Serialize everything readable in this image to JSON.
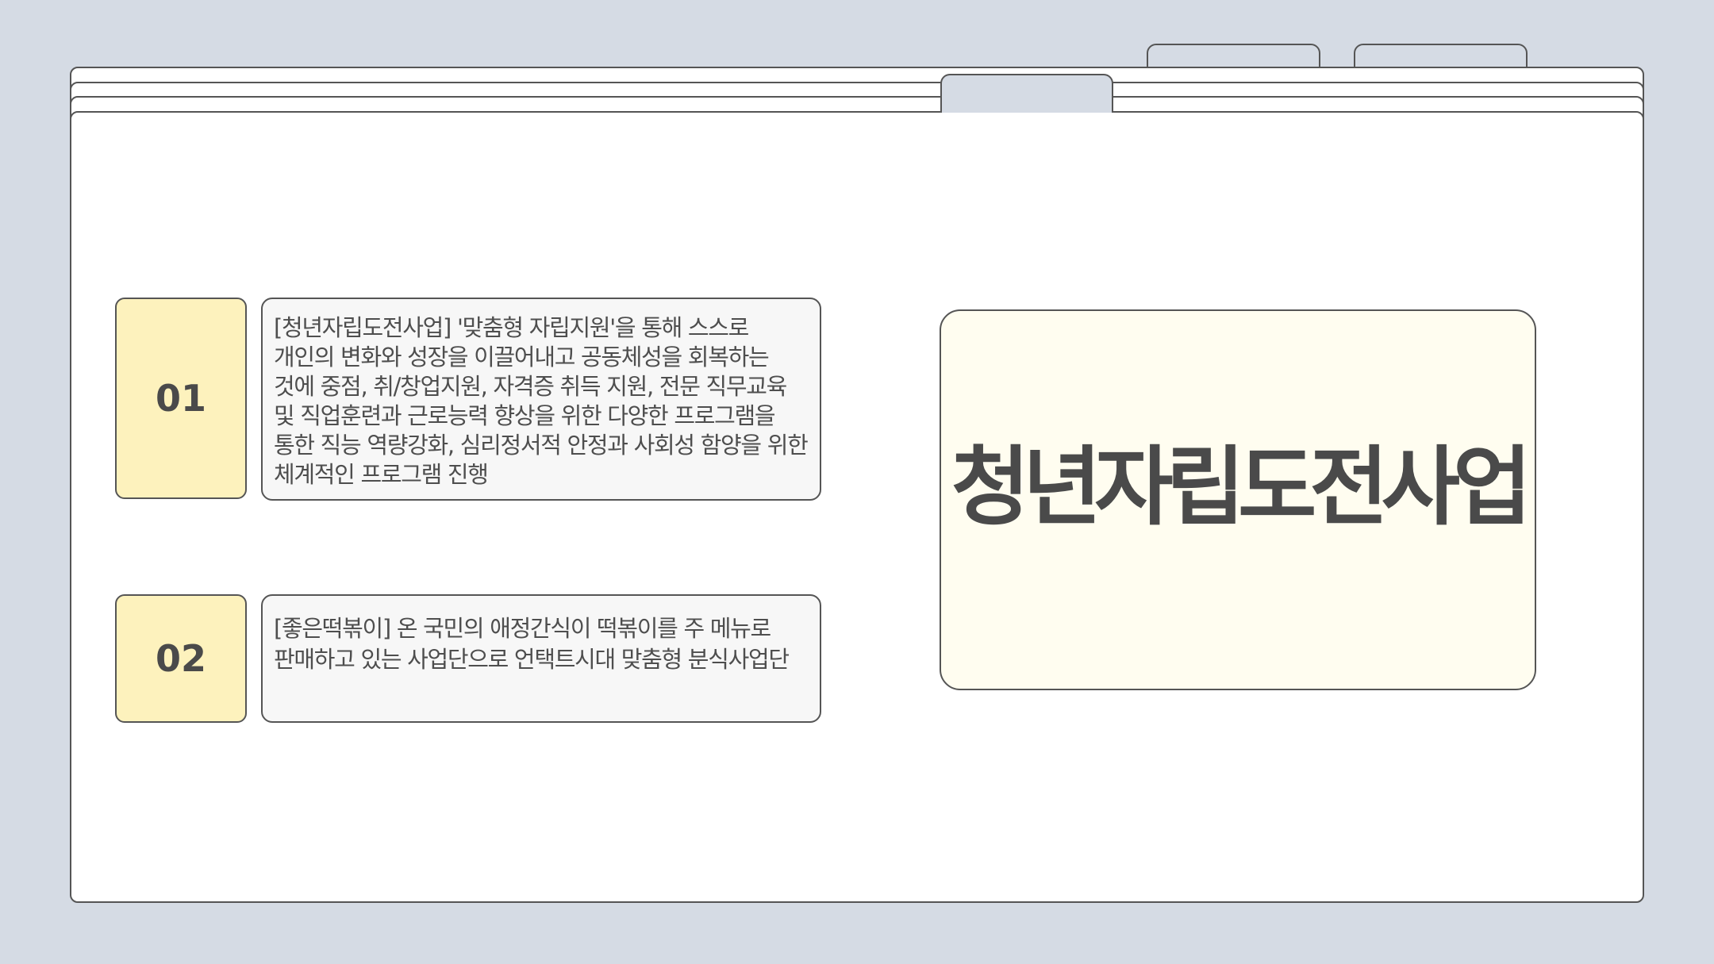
{
  "items": [
    {
      "number": "01",
      "text": "[청년자립도전사업] '맞춤형 자립지원'을 통해 스스로 개인의 변화와 성장을 이끌어내고 공동체성을 회복하는 것에 중점, 취/창업지원, 자격증 취득 지원, 전문 직무교육 및 직업훈련과 근로능력 향상을 위한 다양한 프로그램을 통한 직능 역량강화, 심리정서적 안정과 사회성 함양을 위한 체계적인 프로그램 진행"
    },
    {
      "number": "02",
      "text": "[좋은떡볶이] 온 국민의 애정간식이 떡볶이를 주 메뉴로 판매하고 있는 사업단으로 언택트시대 맞춤형 분식사업단"
    }
  ],
  "title": "청년자립도전사업"
}
